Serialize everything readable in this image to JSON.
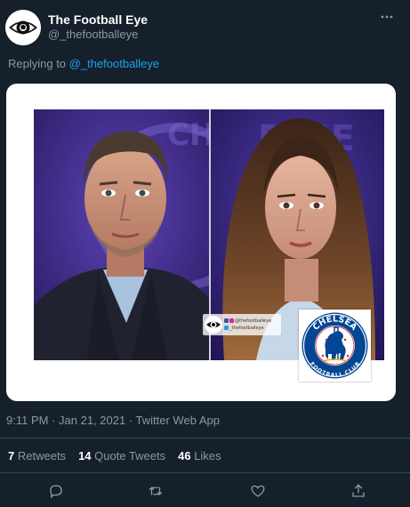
{
  "author": {
    "display_name": "The Football Eye",
    "handle": "@_thefootballeye",
    "avatar_icon": "eye-logo-icon"
  },
  "reply": {
    "prefix": "Replying to",
    "mention": "@_thefootballeye"
  },
  "media": {
    "badge_top_text": "CHELSEA",
    "badge_bottom_text": "FOOTBALL CLUB",
    "watermark_line1": "@thefootballeye",
    "watermark_line2": "_thefootballeye"
  },
  "meta": {
    "time": "9:11 PM",
    "separator1": " · ",
    "date": "Jan 21, 2021",
    "separator2": " · ",
    "source": "Twitter Web App"
  },
  "stats": {
    "retweets_count": "7",
    "retweets_label": "Retweets",
    "quotes_count": "14",
    "quotes_label": "Quote Tweets",
    "likes_count": "46",
    "likes_label": "Likes"
  },
  "actions": [
    "reply-icon",
    "retweet-icon",
    "like-icon",
    "share-icon"
  ],
  "colors": {
    "background": "#15202b",
    "muted": "#8899a6",
    "link": "#1da1f2",
    "divider": "#38444d",
    "chelsea_blue": "#034694"
  }
}
